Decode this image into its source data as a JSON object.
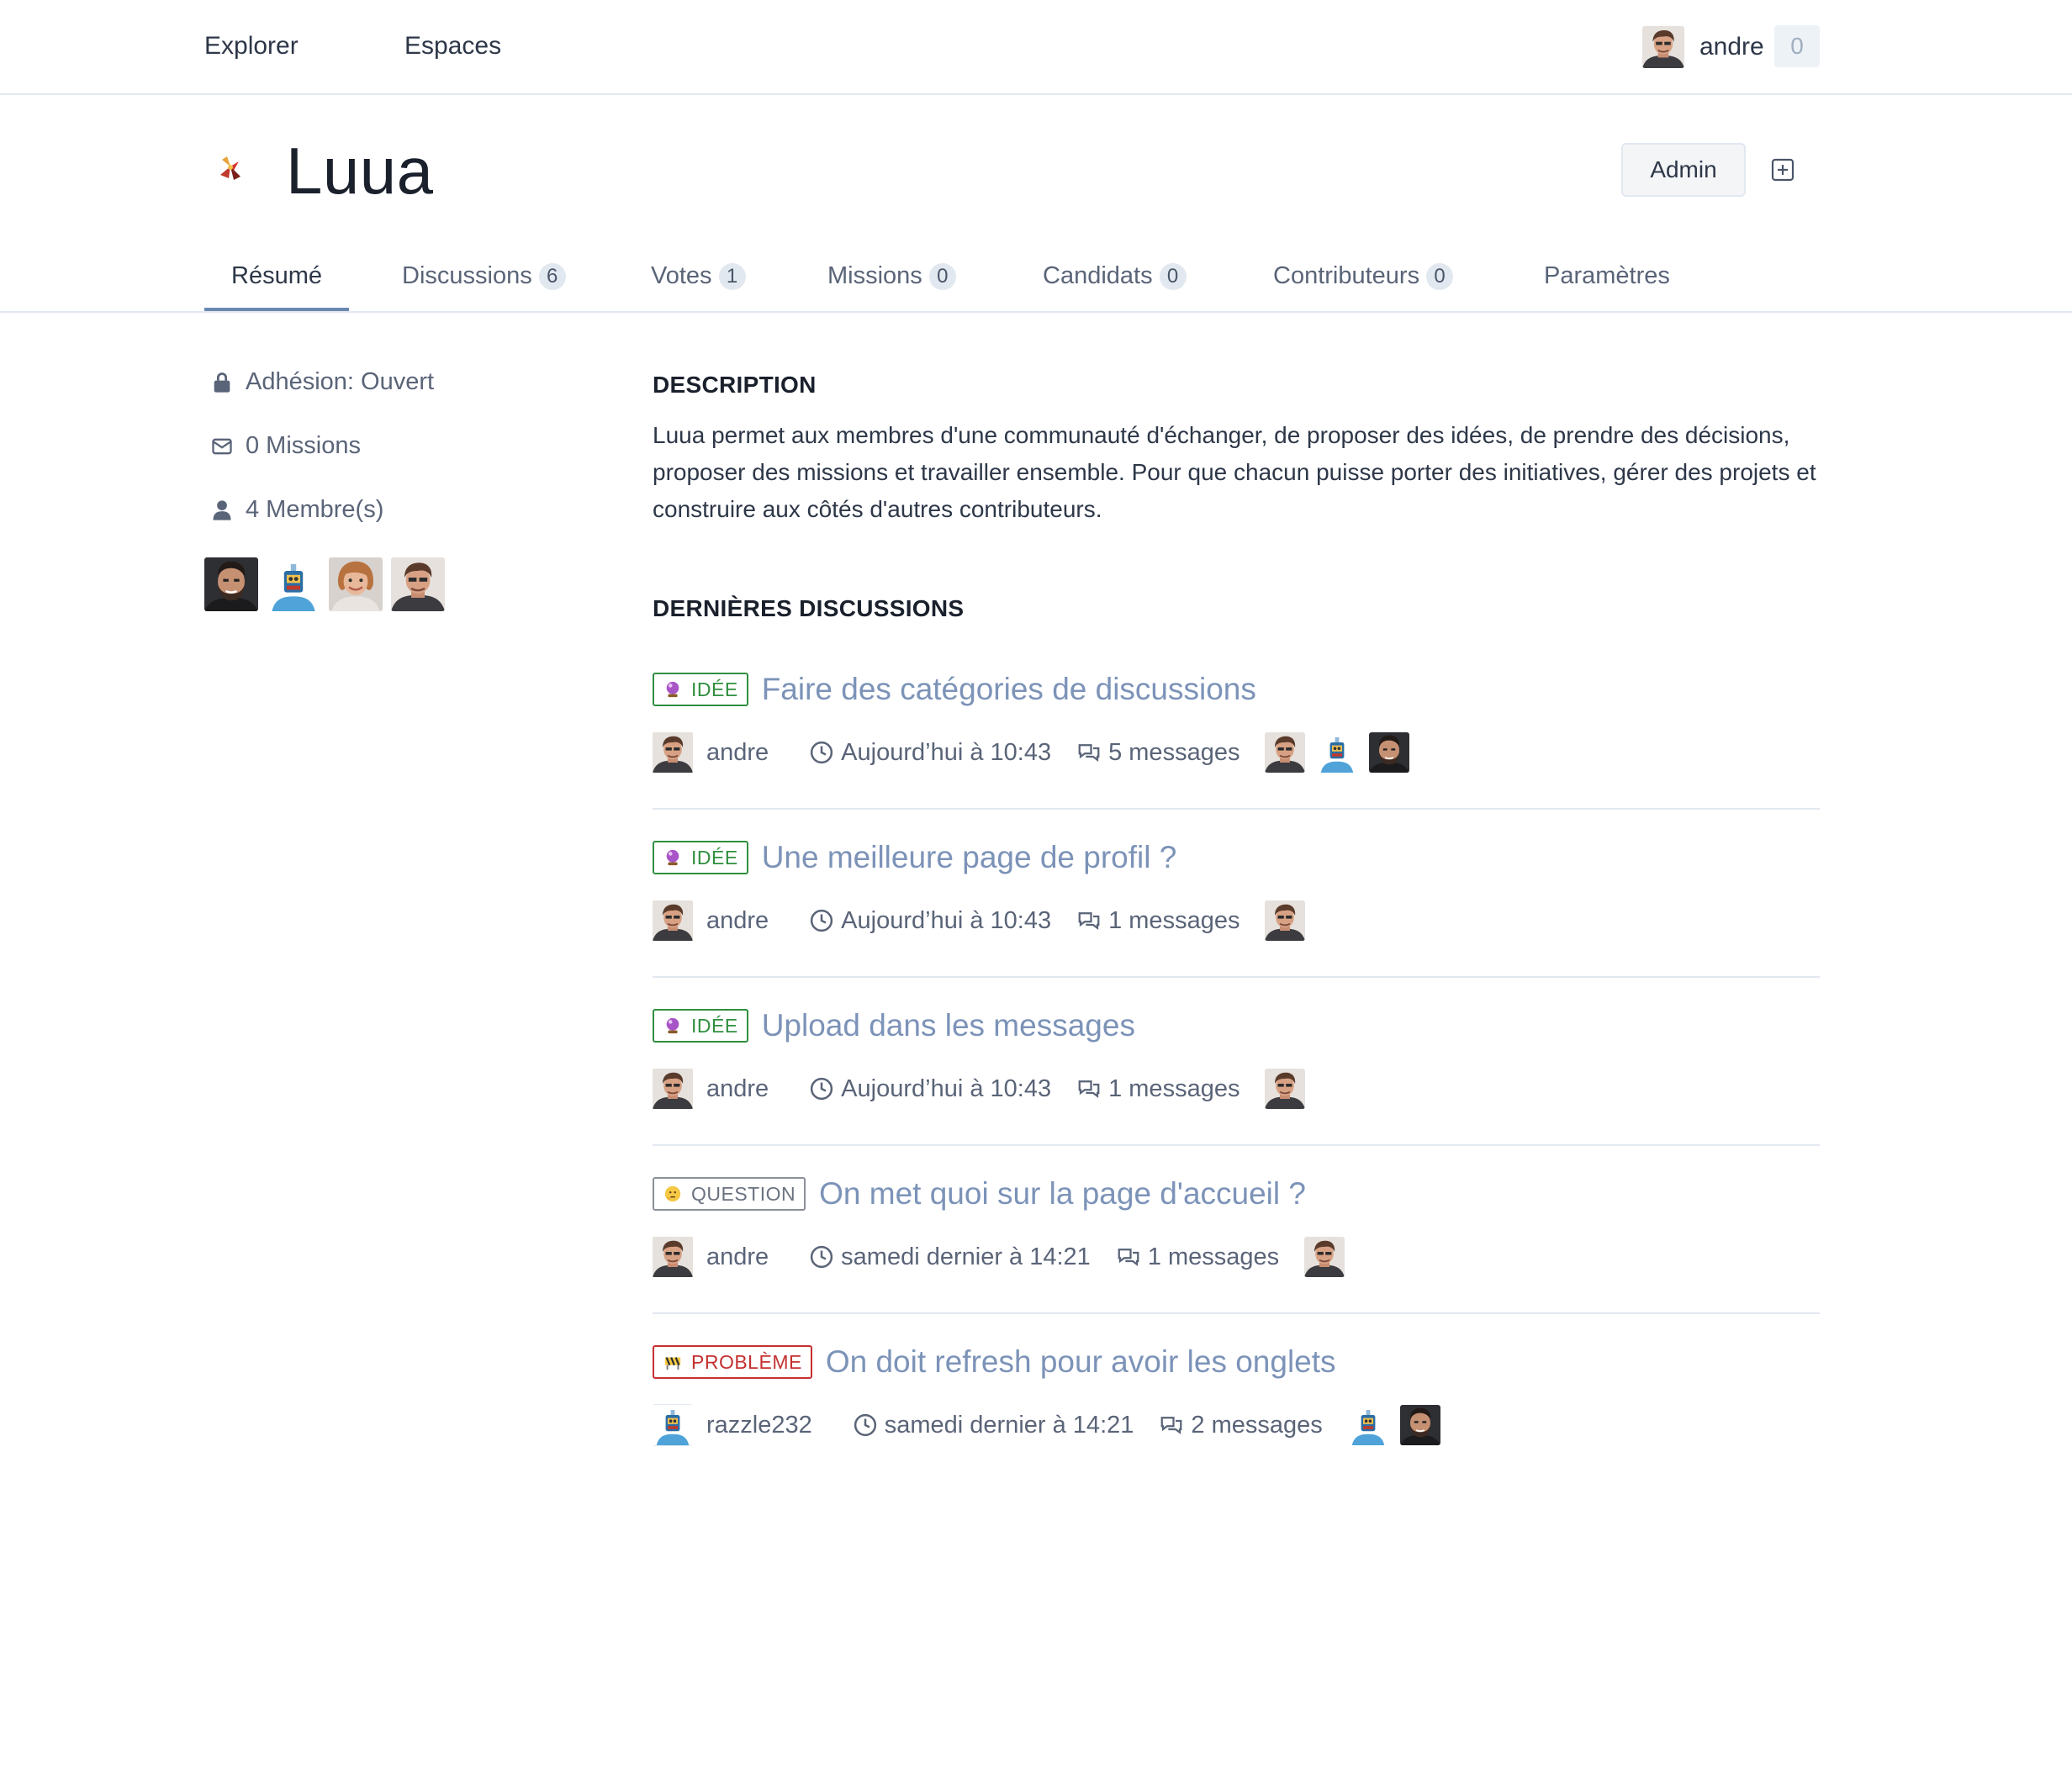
{
  "nav": {
    "explore": "Explorer",
    "spaces": "Espaces",
    "username": "andre",
    "notifications": "0"
  },
  "space": {
    "name": "Luua",
    "admin_label": "Admin"
  },
  "tabs": [
    {
      "label": "Résumé",
      "count": null
    },
    {
      "label": "Discussions",
      "count": "6"
    },
    {
      "label": "Votes",
      "count": "1"
    },
    {
      "label": "Missions",
      "count": "0"
    },
    {
      "label": "Candidats",
      "count": "0"
    },
    {
      "label": "Contributeurs",
      "count": "0"
    },
    {
      "label": "Paramètres",
      "count": null
    }
  ],
  "sidebar": {
    "membership": "Adhésion: Ouvert",
    "missions": "0 Missions",
    "members": "4 Membre(s)"
  },
  "main": {
    "description_title": "DESCRIPTION",
    "description": "Luua permet aux membres d'une communauté d'échanger, de proposer des idées, de prendre des décisions, proposer des missions et travailler ensemble. Pour que chacun puisse porter des initiatives, gérer des projets et construire aux côtés d'autres contributeurs.",
    "discussions_title": "DERNIÈRES DISCUSSIONS"
  },
  "discussions": [
    {
      "type": "IDÉE",
      "title": "Faire des catégories de discussions",
      "author": "andre",
      "time": "Aujourd’hui à 10:43",
      "messages": "5 messages"
    },
    {
      "type": "IDÉE",
      "title": "Une meilleure page de profil ?",
      "author": "andre",
      "time": "Aujourd’hui à 10:43",
      "messages": "1 messages"
    },
    {
      "type": "IDÉE",
      "title": "Upload dans les messages",
      "author": "andre",
      "time": "Aujourd’hui à 10:43",
      "messages": "1 messages"
    },
    {
      "type": "QUESTION",
      "title": "On met quoi sur la page d'accueil ?",
      "author": "andre",
      "time": "samedi dernier à 14:21",
      "messages": "1 messages"
    },
    {
      "type": "PROBLÈME",
      "title": "On doit refresh pour avoir les onglets",
      "author": "razzle232",
      "time": "samedi dernier à 14:21",
      "messages": "2 messages"
    }
  ],
  "colors": {
    "accent": "#6b86b1",
    "link": "#7c93b8",
    "idee": "#2f8f3e",
    "probleme": "#c53030"
  }
}
